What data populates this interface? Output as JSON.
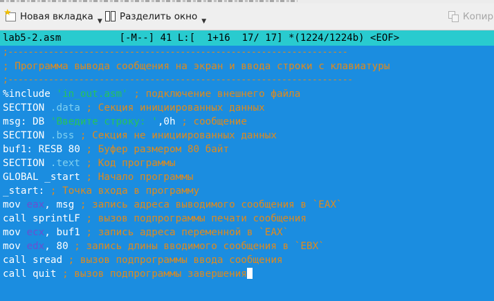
{
  "toolbar": {
    "new_tab_label": "Новая вкладка",
    "split_label": "Разделить окно",
    "copy_label": "Копир",
    "new_tab_icon": "new-tab-icon",
    "split_icon": "split-window-icon",
    "copy_icon": "copy-icon"
  },
  "editor": {
    "status_line": "lab5-2.asm          [-M--] 41 L:[  1+16  17/ 17] *(1224/1224b) <EOF>",
    "colors": {
      "background": "#1b8de0",
      "status_bar": "#29cbcf",
      "comment": "#e08a1c",
      "string": "#27c35a",
      "register": "#6a4fd0",
      "section": "#7fd0f0"
    },
    "lines": [
      [
        {
          "t": ";-------------------------------------------------------------------",
          "c": "sep"
        }
      ],
      [
        {
          "t": "; Программа вывода сообщения на экран и ввода строки с клавиатуры",
          "c": "comment"
        }
      ],
      [
        {
          "t": ";--------------------------------------------------------------------",
          "c": "sep"
        }
      ],
      [
        {
          "t": "%include ",
          "c": "text"
        },
        {
          "t": "'in_out.asm'",
          "c": "string"
        },
        {
          "t": " ; подключение внешнего файла",
          "c": "comment"
        }
      ],
      [
        {
          "t": "SECTION ",
          "c": "text"
        },
        {
          "t": ".data",
          "c": "sect"
        },
        {
          "t": " ; Секция инициированных данных",
          "c": "comment"
        }
      ],
      [
        {
          "t": "msg: DB ",
          "c": "text"
        },
        {
          "t": "'Введите строку: '",
          "c": "string"
        },
        {
          "t": ",0h",
          "c": "text"
        },
        {
          "t": " ; сообщение",
          "c": "comment"
        }
      ],
      [
        {
          "t": "SECTION ",
          "c": "text"
        },
        {
          "t": ".bss",
          "c": "sect"
        },
        {
          "t": " ; Секция не инициированных данных",
          "c": "comment"
        }
      ],
      [
        {
          "t": "buf1: RESB 80",
          "c": "text"
        },
        {
          "t": " ; Буфер размером 80 байт",
          "c": "comment"
        }
      ],
      [
        {
          "t": "SECTION ",
          "c": "text"
        },
        {
          "t": ".text",
          "c": "sect"
        },
        {
          "t": " ; Код программы",
          "c": "comment"
        }
      ],
      [
        {
          "t": "GLOBAL _start",
          "c": "text"
        },
        {
          "t": " ; Начало программы",
          "c": "comment"
        }
      ],
      [
        {
          "t": "_start:",
          "c": "text"
        },
        {
          "t": " ; Точка входа в программу",
          "c": "comment"
        }
      ],
      [
        {
          "t": "mov ",
          "c": "text"
        },
        {
          "t": "eax",
          "c": "reg"
        },
        {
          "t": ", msg",
          "c": "text"
        },
        {
          "t": " ; запись адреса выводимого сообщения в `EAX`",
          "c": "comment"
        }
      ],
      [
        {
          "t": "call sprintLF",
          "c": "text"
        },
        {
          "t": " ; вызов подпрограммы печати сообщения",
          "c": "comment"
        }
      ],
      [
        {
          "t": "mov ",
          "c": "text"
        },
        {
          "t": "ecx",
          "c": "reg"
        },
        {
          "t": ", buf1",
          "c": "text"
        },
        {
          "t": " ; запись адреса переменной в `EAX`",
          "c": "comment"
        }
      ],
      [
        {
          "t": "mov ",
          "c": "text"
        },
        {
          "t": "edx",
          "c": "reg"
        },
        {
          "t": ", 80",
          "c": "text"
        },
        {
          "t": " ; запись длины вводимого сообщения в `EBX`",
          "c": "comment"
        }
      ],
      [
        {
          "t": "call sread",
          "c": "text"
        },
        {
          "t": " ; вызов подпрограммы ввода сообщения",
          "c": "comment"
        }
      ],
      [
        {
          "t": "call quit",
          "c": "text"
        },
        {
          "t": " ; вызов подпрограммы завершения",
          "c": "comment"
        }
      ]
    ]
  }
}
